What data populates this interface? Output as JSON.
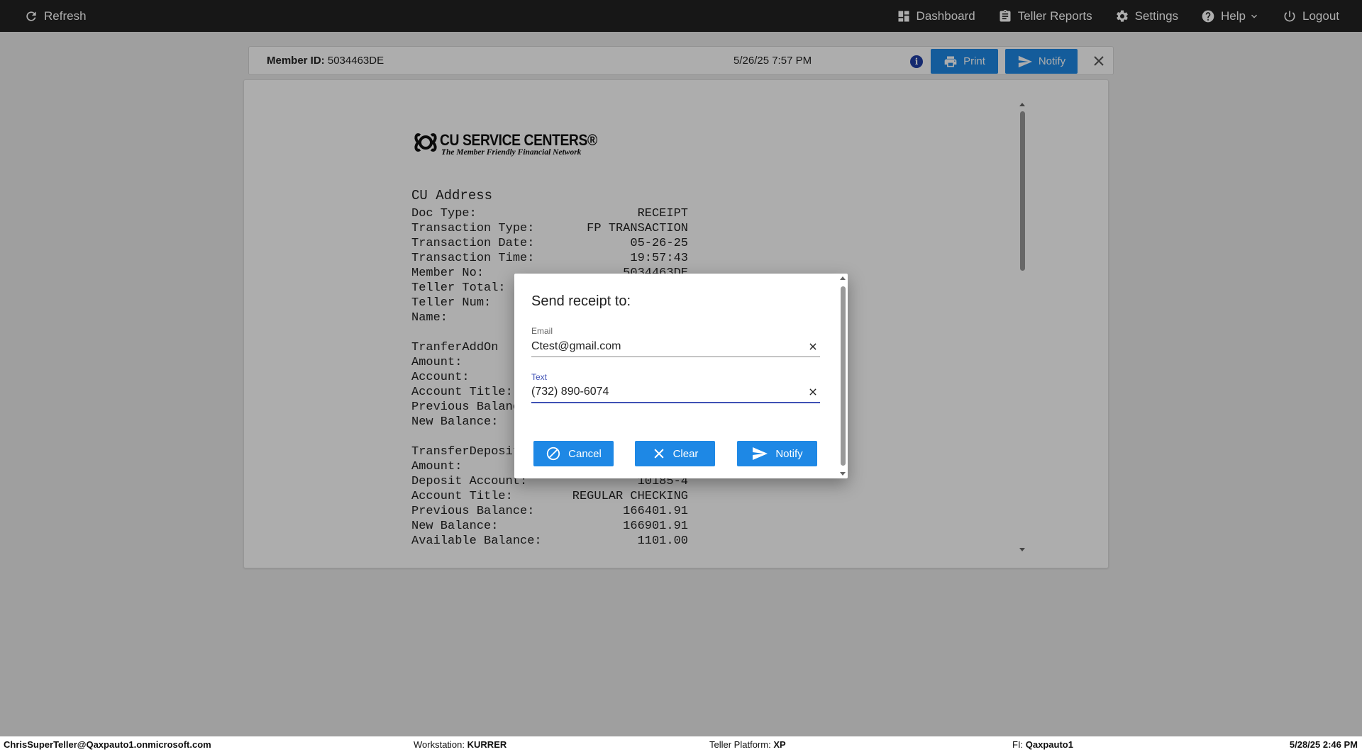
{
  "topbar": {
    "refresh_label": "Refresh",
    "dashboard_label": "Dashboard",
    "teller_reports_label": "Teller Reports",
    "settings_label": "Settings",
    "help_label": "Help",
    "logout_label": "Logout"
  },
  "header": {
    "member_label": "Member ID:",
    "member_id": "5034463DE",
    "datetime": "5/26/25 7:57 PM",
    "info_icon": "i",
    "print_label": "Print",
    "notify_label": "Notify"
  },
  "logo": {
    "title": "CU SERVICE CENTERS®",
    "subtitle": "The Member Friendly Financial Network"
  },
  "receipt": {
    "address": "CU Address",
    "group1": [
      {
        "k": "Doc Type:",
        "v": "RECEIPT"
      },
      {
        "k": "Transaction Type:",
        "v": "FP TRANSACTION"
      },
      {
        "k": "Transaction Date:",
        "v": "05-26-25"
      },
      {
        "k": "Transaction Time:",
        "v": "19:57:43"
      },
      {
        "k": "Member No:",
        "v": "5034463DE"
      },
      {
        "k": "Teller Total:",
        "v": ""
      },
      {
        "k": "Teller Num:",
        "v": ""
      },
      {
        "k": "Name:",
        "v": ""
      }
    ],
    "group2": [
      {
        "k": "TranferAddOn",
        "v": ""
      },
      {
        "k": "Amount:",
        "v": ""
      },
      {
        "k": "Account:",
        "v": ""
      },
      {
        "k": "Account Title:",
        "v": ""
      },
      {
        "k": "Previous Balance:",
        "v": ""
      },
      {
        "k": "New Balance:",
        "v": ""
      }
    ],
    "group3": [
      {
        "k": "TransferDeposit",
        "v": ""
      },
      {
        "k": "Amount:",
        "v": ""
      },
      {
        "k": "Deposit Account:",
        "v": "10185-4"
      },
      {
        "k": "Account Title:",
        "v": "REGULAR CHECKING"
      },
      {
        "k": "Previous Balance:",
        "v": "166401.91"
      },
      {
        "k": "New Balance:",
        "v": "166901.91"
      },
      {
        "k": "Available Balance:",
        "v": "1101.00"
      }
    ]
  },
  "dialog": {
    "title": "Send receipt to:",
    "email_label": "Email",
    "email_value": "Ctest@gmail.com",
    "text_label": "Text",
    "text_value": "(732) 890-6074",
    "cancel_label": "Cancel",
    "clear_label": "Clear",
    "notify_label": "Notify"
  },
  "footer": {
    "user": "ChrisSuperTeller@Qaxpauto1.onmicrosoft.com",
    "workstation_label": "Workstation:",
    "workstation": "KURRER",
    "platform_label": "Teller Platform:",
    "platform": "XP",
    "fi_label": "FI:",
    "fi": "Qaxpauto1",
    "datetime": "5/28/25 2:46 PM"
  },
  "colors": {
    "accent": "#1e88e5",
    "topbar": "#222222",
    "focus": "#3f51b5"
  }
}
